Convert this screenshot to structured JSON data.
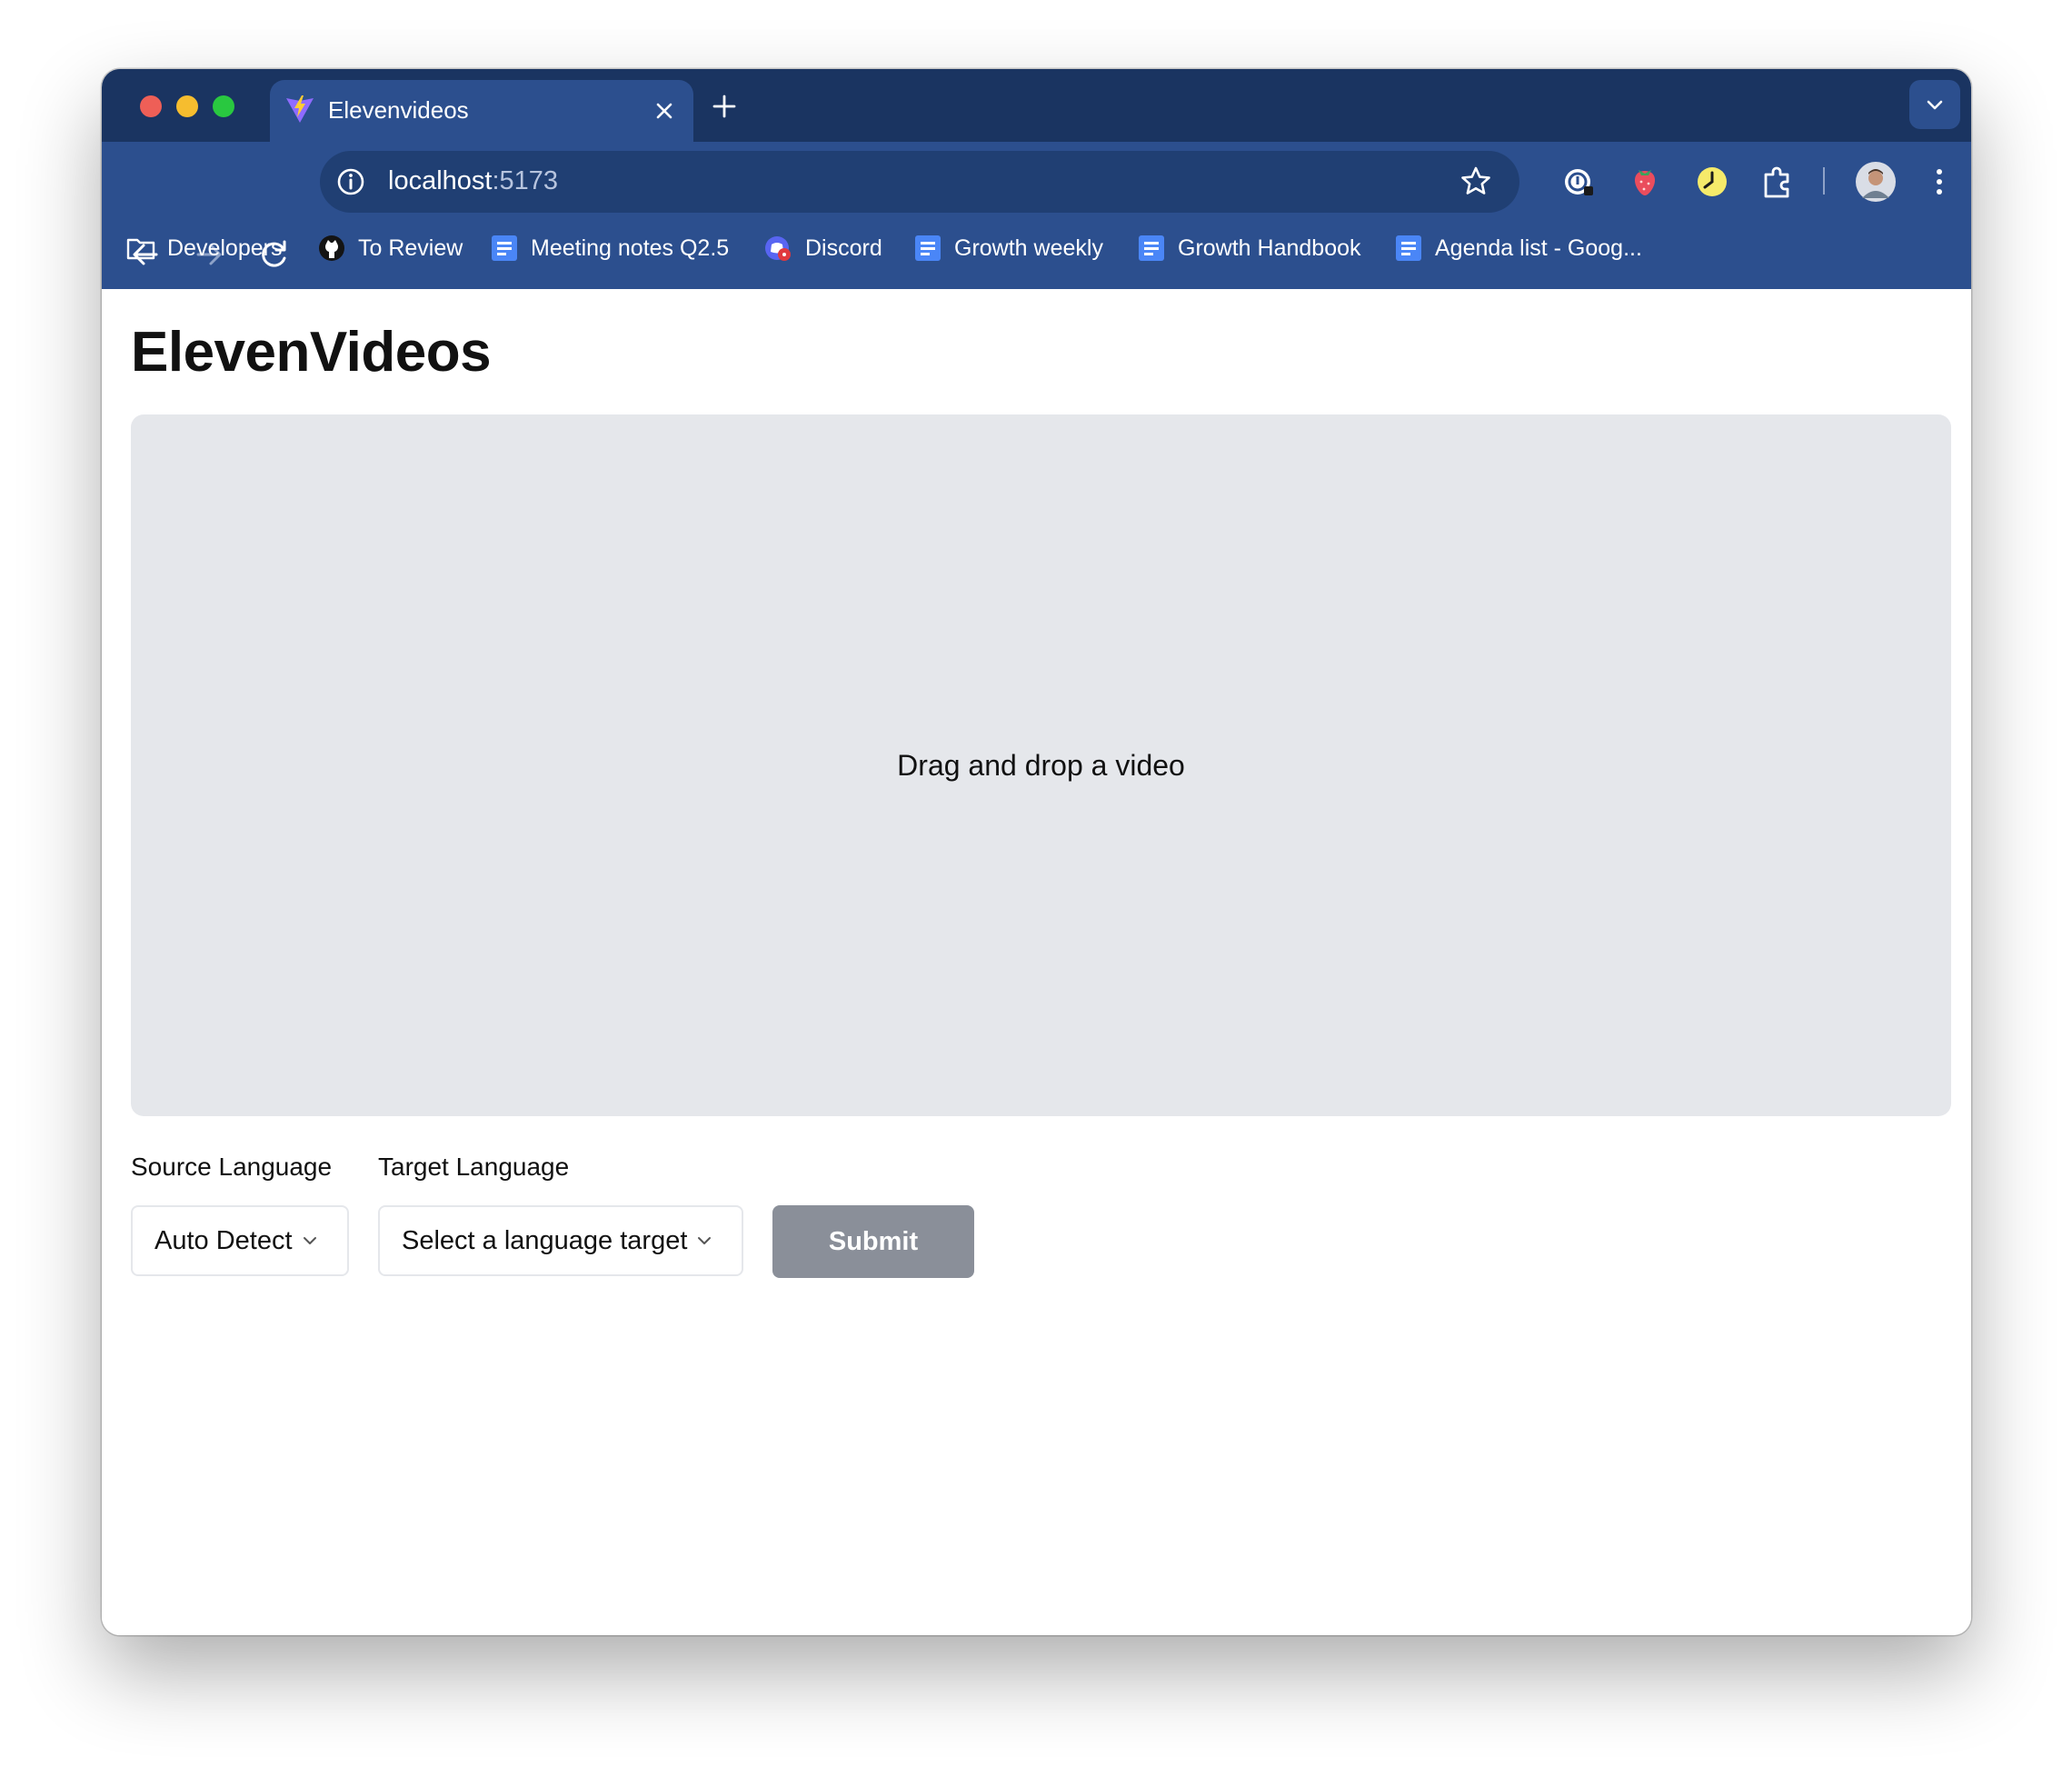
{
  "browser": {
    "tab": {
      "title": "Elevenvideos"
    },
    "address_bar": {
      "host": "localhost",
      "port": ":5173"
    },
    "bookmarks": [
      {
        "label": "Developers",
        "icon": "folder-icon"
      },
      {
        "label": "To Review",
        "icon": "github-icon"
      },
      {
        "label": "Meeting notes Q2.5",
        "icon": "doc-icon"
      },
      {
        "label": "Discord",
        "icon": "discord-icon"
      },
      {
        "label": "Growth weekly",
        "icon": "doc-icon"
      },
      {
        "label": "Growth Handbook",
        "icon": "doc-icon"
      },
      {
        "label": "Agenda list - Goog...",
        "icon": "doc-icon"
      }
    ],
    "colors": {
      "frame": "#1a3461",
      "toolbar": "#2c4f8e",
      "omnibox": "#203f73"
    }
  },
  "page": {
    "title": "ElevenVideos",
    "dropzone": {
      "text": "Drag and drop a video"
    },
    "source_language": {
      "label": "Source Language",
      "value": "Auto Detect"
    },
    "target_language": {
      "label": "Target Language",
      "value": "Select a language target"
    },
    "submit": {
      "label": "Submit"
    },
    "colors": {
      "dropzone_bg": "#e5e7eb",
      "submit_bg": "#8a8f99"
    }
  }
}
